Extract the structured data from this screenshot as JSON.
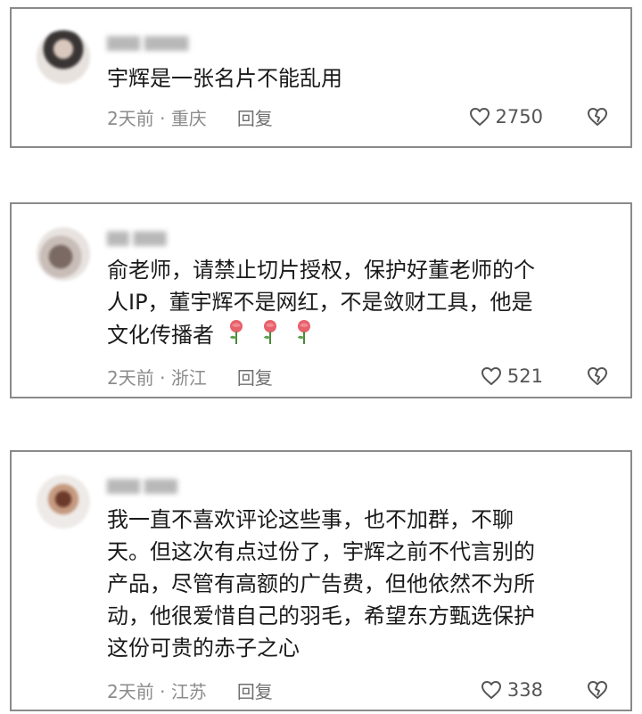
{
  "comments": [
    {
      "content": "宇辉是一张名片不能乱用",
      "time": "2天前",
      "separator": "·",
      "location": "重庆",
      "reply_label": "回复",
      "likes": "2750"
    },
    {
      "content": "俞老师，请禁止切片授权，保护好董老师的个\n人IP，董宇辉不是网红，不是敛财工具，他是\n文化传播者",
      "emoji": [
        "rose",
        "rose",
        "rose"
      ],
      "time": "2天前",
      "separator": "·",
      "location": "浙江",
      "reply_label": "回复",
      "likes": "521"
    },
    {
      "content": "我一直不喜欢评论这些事，也不加群，不聊\n天。但这次有点过份了，宇辉之前不代言别的\n产品，尽管有高额的广告费，但他依然不为所\n动，他很爱惜自己的羽毛，希望东方甄选保护\n这份可贵的赤子之心",
      "time": "2天前",
      "separator": "·",
      "location": "江苏",
      "reply_label": "回复",
      "likes": "338"
    }
  ],
  "colors": {
    "border": "#8a8a8a",
    "text": "#1a1a1a",
    "meta": "#8b8b8b"
  }
}
